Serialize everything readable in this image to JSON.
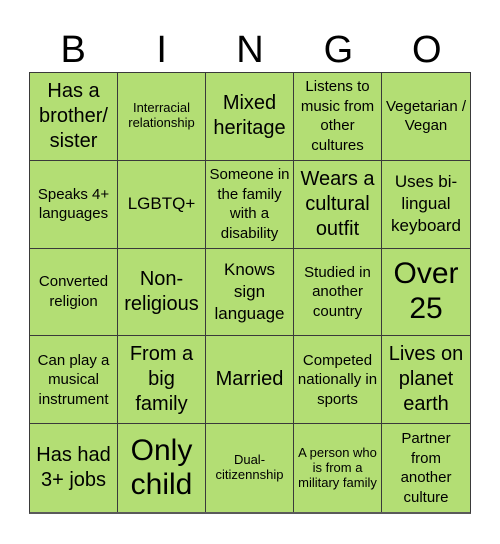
{
  "header": {
    "letters": [
      "B",
      "I",
      "N",
      "G",
      "O"
    ]
  },
  "theme": {
    "cell_color": "#B3DE74",
    "border_color": "#3A3A3A"
  },
  "board": {
    "rows": [
      [
        "Has a brother/ sister",
        "Interracial relationship",
        "Mixed heritage",
        "Listens to music from other cultures",
        "Vegetarian / Vegan"
      ],
      [
        "Speaks 4+ languages",
        "LGBTQ+",
        "Someone in the family with a disability",
        "Wears a cultural outfit",
        "Uses bi-lingual keyboard"
      ],
      [
        "Converted religion",
        "Non-religious",
        "Knows sign language",
        "Studied in another country",
        "Over 25"
      ],
      [
        "Can play a musical instrument",
        "From a big family",
        "Married",
        "Competed nationally in sports",
        "Lives on planet earth"
      ],
      [
        "Has had 3+ jobs",
        "Only child",
        "Dual-citizennship",
        "A person who is from a military family",
        "Partner from another culture"
      ]
    ]
  }
}
